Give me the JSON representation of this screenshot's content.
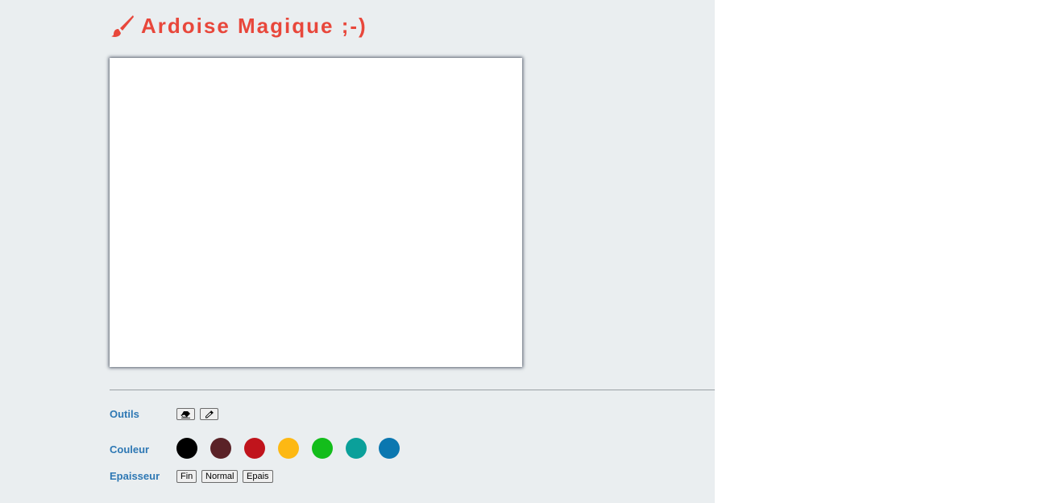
{
  "header": {
    "title": "Ardoise Magique ;-)",
    "icon": "paintbrush-icon",
    "color": "#e8473b"
  },
  "toolbar": {
    "tools_label": "Outils",
    "tools": [
      {
        "name": "eraser",
        "icon": "eraser-icon"
      },
      {
        "name": "picker",
        "icon": "eyedropper-icon"
      }
    ],
    "color_label": "Couleur",
    "colors": [
      "#000000",
      "#5a2227",
      "#c0141c",
      "#fdb813",
      "#13bd1b",
      "#0ba09a",
      "#0b77b0"
    ],
    "thickness_label": "Epaisseur",
    "thickness": [
      "Fin",
      "Normal",
      "Epais"
    ]
  },
  "theme": {
    "label_color": "#2e78b4",
    "background": "#eaeef0"
  }
}
